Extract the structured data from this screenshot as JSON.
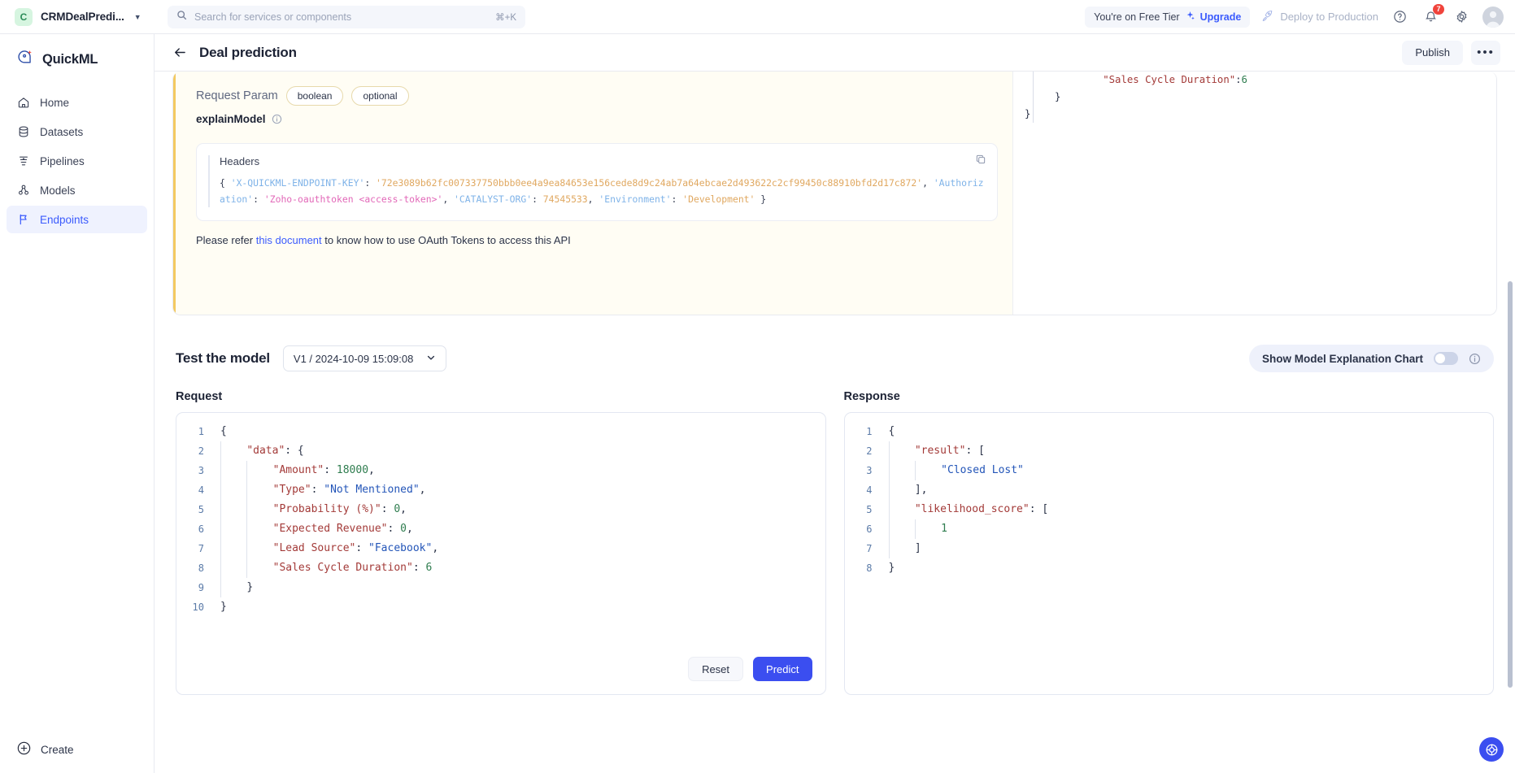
{
  "topbar": {
    "org_initial": "C",
    "org_name": "CRMDealPredi...",
    "search": {
      "placeholder": "Search for services or components",
      "value": "",
      "shortcut": "⌘+K"
    },
    "tier_text": "You're on Free Tier",
    "upgrade_label": "Upgrade",
    "deploy_label": "Deploy to Production",
    "notification_count": "7"
  },
  "sidebar": {
    "brand": "QuickML",
    "items": [
      {
        "label": "Home",
        "icon": "home-icon"
      },
      {
        "label": "Datasets",
        "icon": "database-icon"
      },
      {
        "label": "Pipelines",
        "icon": "pipeline-icon"
      },
      {
        "label": "Models",
        "icon": "models-icon"
      },
      {
        "label": "Endpoints",
        "icon": "flag-icon"
      }
    ],
    "create_label": "Create"
  },
  "page": {
    "title": "Deal prediction",
    "publish_label": "Publish",
    "more_label": "•••"
  },
  "api": {
    "request_param_label": "Request Param",
    "chips": [
      "boolean",
      "optional"
    ],
    "param_name": "explainModel",
    "headers_title": "Headers",
    "headers_code": [
      {
        "t": "{ ",
        "c": "punct"
      },
      {
        "t": "'X-QUICKML-ENDPOINT-KEY'",
        "c": "key"
      },
      {
        "t": ": ",
        "c": "punct"
      },
      {
        "t": "'72e3089b62fc007337750bbb0ee4a9ea84653e156cede8d9c24ab7a64ebcae2d493622c2cf99450c88910bfd2d17c872'",
        "c": "str"
      },
      {
        "t": ", ",
        "c": "punct"
      },
      {
        "t": "'Authorization'",
        "c": "key"
      },
      {
        "t": ": ",
        "c": "punct"
      },
      {
        "t": "'Zoho-oauthtoken <access-token>'",
        "c": "pink"
      },
      {
        "t": ", ",
        "c": "punct"
      },
      {
        "t": "'CATALYST-ORG'",
        "c": "key"
      },
      {
        "t": ": ",
        "c": "punct"
      },
      {
        "t": "74545533",
        "c": "num"
      },
      {
        "t": ", ",
        "c": "punct"
      },
      {
        "t": "'Environment'",
        "c": "key"
      },
      {
        "t": ": ",
        "c": "punct"
      },
      {
        "t": "'Development'",
        "c": "str"
      },
      {
        "t": " }",
        "c": "punct"
      }
    ],
    "refer_prefix": "Please refer ",
    "refer_link": "this document",
    "refer_suffix": " to know how to use OAuth Tokens to access this API",
    "right_snippet": [
      {
        "indent": 12,
        "key": "\"Sales Cycle Duration\"",
        "sep": ": ",
        "val": "6",
        "valtype": "num"
      },
      {
        "indent": 4,
        "raw": "}"
      },
      {
        "indent": 0,
        "raw": "}"
      }
    ]
  },
  "test": {
    "title": "Test the model",
    "version_value": "V1 / 2024-10-09 15:09:08",
    "explain_label": "Show Model Explanation Chart",
    "toggle_on": false,
    "request_label": "Request",
    "response_label": "Response",
    "reset_label": "Reset",
    "predict_label": "Predict",
    "request_lines": [
      {
        "n": "1",
        "depth": 0,
        "text": "{"
      },
      {
        "n": "2",
        "depth": 1,
        "text": "\"data\": {"
      },
      {
        "n": "3",
        "depth": 2,
        "text": "\"Amount\": 18000,"
      },
      {
        "n": "4",
        "depth": 2,
        "text": "\"Type\": \"Not Mentioned\","
      },
      {
        "n": "5",
        "depth": 2,
        "text": "\"Probability (%)\": 0,"
      },
      {
        "n": "6",
        "depth": 2,
        "text": "\"Expected Revenue\": 0,"
      },
      {
        "n": "7",
        "depth": 2,
        "text": "\"Lead Source\": \"Facebook\","
      },
      {
        "n": "8",
        "depth": 2,
        "text": "\"Sales Cycle Duration\": 6"
      },
      {
        "n": "9",
        "depth": 1,
        "text": "}"
      },
      {
        "n": "10",
        "depth": 0,
        "text": "}"
      }
    ],
    "response_lines": [
      {
        "n": "1",
        "depth": 0,
        "text": "{"
      },
      {
        "n": "2",
        "depth": 1,
        "text": "\"result\": ["
      },
      {
        "n": "3",
        "depth": 2,
        "text": "\"Closed Lost\""
      },
      {
        "n": "4",
        "depth": 1,
        "text": "],"
      },
      {
        "n": "5",
        "depth": 1,
        "text": "\"likelihood_score\": ["
      },
      {
        "n": "6",
        "depth": 2,
        "text": "1"
      },
      {
        "n": "7",
        "depth": 1,
        "text": "]"
      },
      {
        "n": "8",
        "depth": 0,
        "text": "}"
      }
    ]
  },
  "colors": {
    "accent": "#3b5bfd",
    "primary_button": "#3b4ef0",
    "json_key": "#a33a38",
    "json_string": "#2355b8",
    "json_number": "#2f7d4f",
    "warning_bg": "#fffdf4"
  }
}
